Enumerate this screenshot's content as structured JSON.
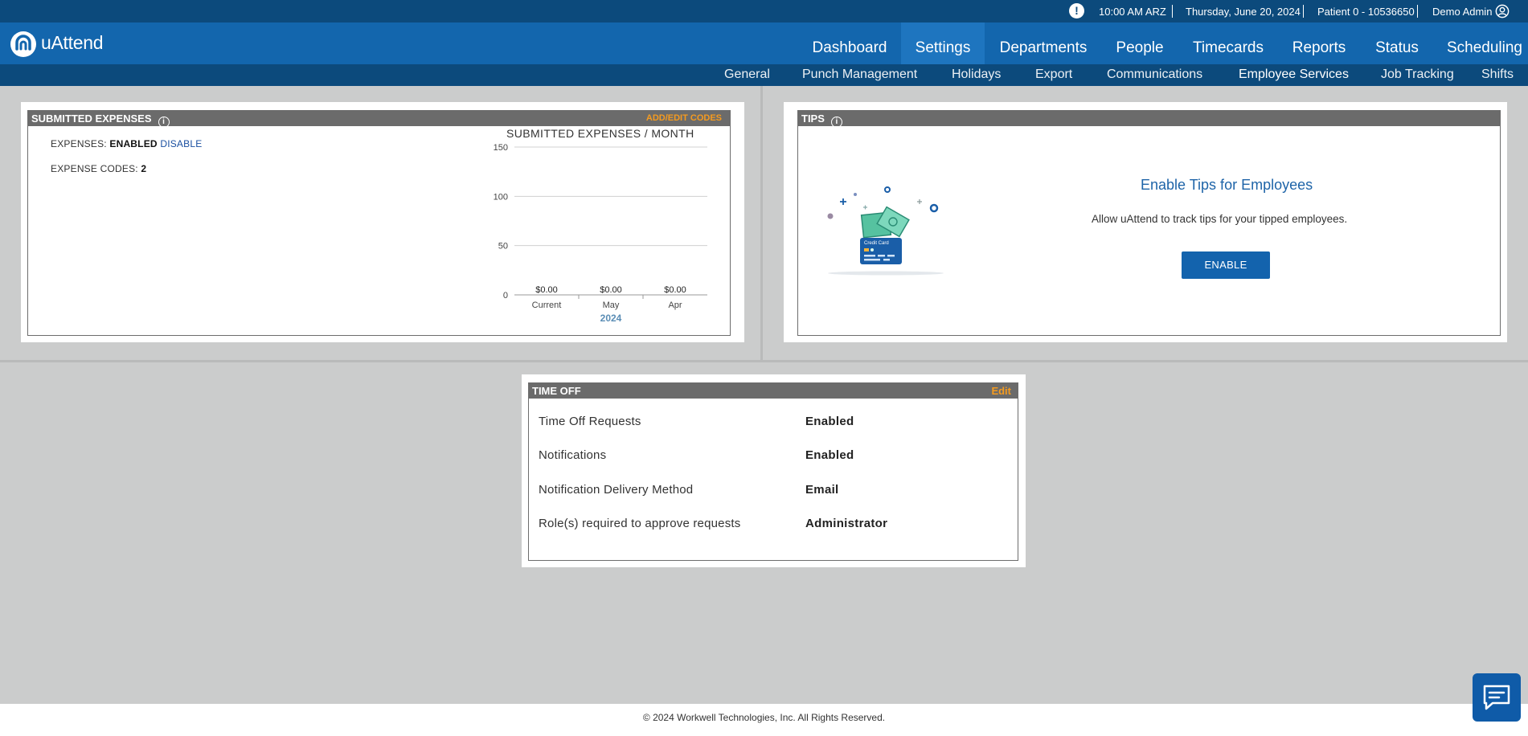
{
  "topbar": {
    "alert_icon": "exclamation-icon",
    "time": "10:00 AM ARZ",
    "date": "Thursday, June 20, 2024",
    "patient": "Patient 0 - 10536650",
    "user": "Demo Admin",
    "user_icon": "user-circle-icon"
  },
  "app": {
    "logo_text": "uAttend"
  },
  "nav": {
    "items": [
      {
        "label": "Dashboard"
      },
      {
        "label": "Settings"
      },
      {
        "label": "Departments"
      },
      {
        "label": "People"
      },
      {
        "label": "Timecards"
      },
      {
        "label": "Reports"
      },
      {
        "label": "Status"
      },
      {
        "label": "Scheduling"
      }
    ],
    "active": "Settings"
  },
  "subnav": {
    "items": [
      {
        "label": "General"
      },
      {
        "label": "Punch Management"
      },
      {
        "label": "Holidays"
      },
      {
        "label": "Export"
      },
      {
        "label": "Communications"
      },
      {
        "label": "Employee Services"
      },
      {
        "label": "Job Tracking"
      },
      {
        "label": "Shifts"
      }
    ],
    "active": "Employee Services"
  },
  "expenses": {
    "title": "SUBMITTED EXPENSES",
    "add_edit_link": "ADD/EDIT CODES",
    "status_label": "EXPENSES:",
    "status_value": "ENABLED",
    "disable_link": "DISABLE",
    "codes_label": "EXPENSE CODES:",
    "codes_value": "2"
  },
  "chart_data": {
    "type": "bar",
    "title": "SUBMITTED EXPENSES / MONTH",
    "categories": [
      "Current",
      "May",
      "Apr"
    ],
    "values": [
      0,
      0,
      0
    ],
    "data_labels": [
      "$0.00",
      "$0.00",
      "$0.00"
    ],
    "ylim": [
      0,
      150
    ],
    "yticks": [
      0,
      50,
      100,
      150
    ],
    "year_label": "2024",
    "grid": true
  },
  "tips": {
    "title": "TIPS",
    "heading": "Enable Tips for Employees",
    "description": "Allow uAttend to track tips for your tipped employees.",
    "button": "ENABLE",
    "card_text": "Credit Card"
  },
  "time_off": {
    "title": "TIME OFF",
    "edit_link": "Edit",
    "rows": [
      {
        "label": "Time Off Requests",
        "value": "Enabled"
      },
      {
        "label": "Notifications",
        "value": "Enabled"
      },
      {
        "label": "Notification Delivery Method",
        "value": "Email"
      },
      {
        "label": "Role(s) required to approve requests",
        "value": "Administrator"
      }
    ]
  },
  "footer": {
    "copyright": "© 2024 Workwell Technologies, Inc. All Rights Reserved."
  },
  "chat": {
    "icon": "chat-bubble-icon"
  },
  "colors": {
    "topbar": "#0c4a7c",
    "nav": "#1366ad",
    "accent_orange": "#f59b1f",
    "button_blue": "#1363ad",
    "panel_header": "#6b6b6b"
  }
}
